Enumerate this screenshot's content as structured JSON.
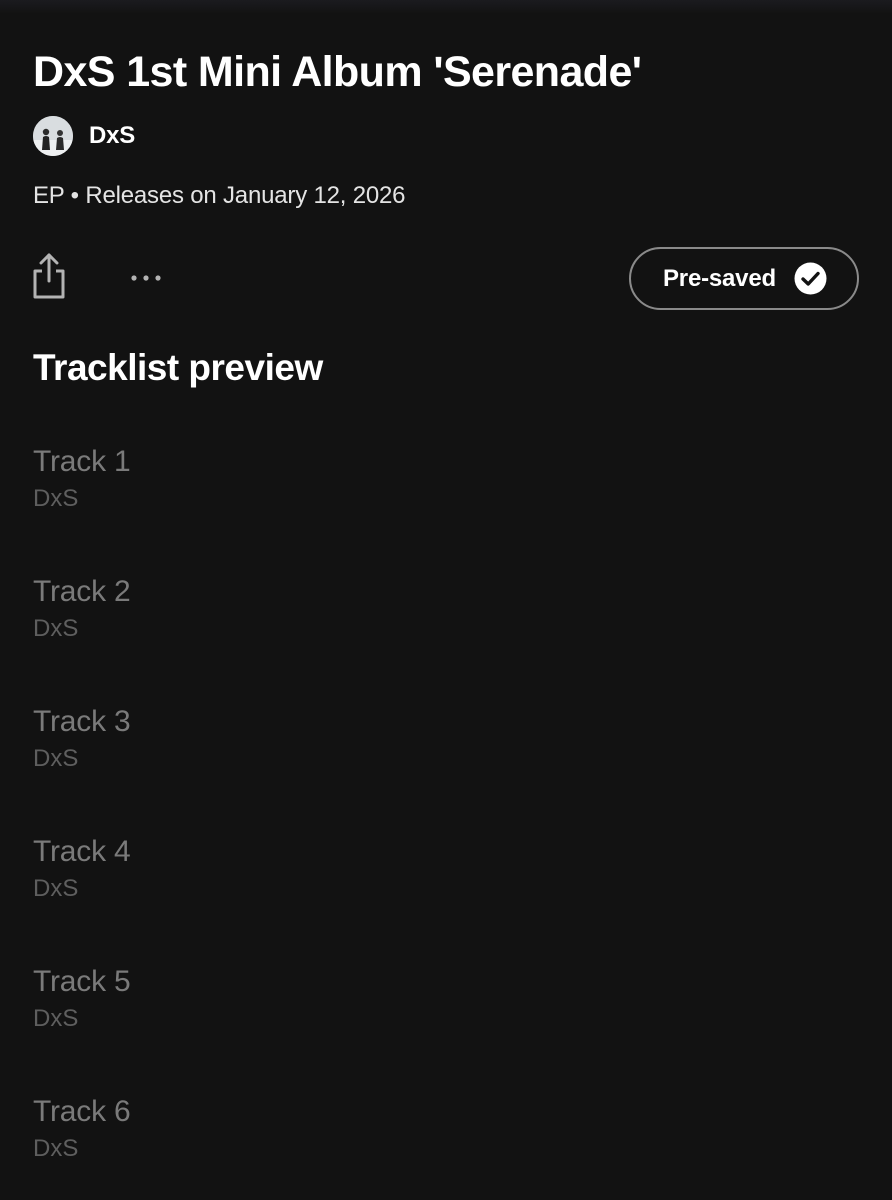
{
  "album": {
    "title": "DxS 1st Mini Album 'Serenade'",
    "artist": "DxS",
    "meta": "EP • Releases on January 12, 2026"
  },
  "actions": {
    "share_icon": "share-icon",
    "more_icon": "more-options-icon",
    "presave_label": "Pre-saved",
    "presave_icon": "check-circle-icon"
  },
  "tracklist": {
    "heading": "Tracklist preview",
    "tracks": [
      {
        "title": "Track 1",
        "artist": "DxS"
      },
      {
        "title": "Track 2",
        "artist": "DxS"
      },
      {
        "title": "Track 3",
        "artist": "DxS"
      },
      {
        "title": "Track 4",
        "artist": "DxS"
      },
      {
        "title": "Track 5",
        "artist": "DxS"
      },
      {
        "title": "Track 6",
        "artist": "DxS"
      }
    ]
  },
  "colors": {
    "background": "#121212",
    "primary_text": "#ffffff",
    "secondary_text": "#e4e4e4",
    "disabled_track_title": "#7a7a7a",
    "disabled_track_artist": "#5e5e5e",
    "button_border": "#8a8a8a"
  }
}
